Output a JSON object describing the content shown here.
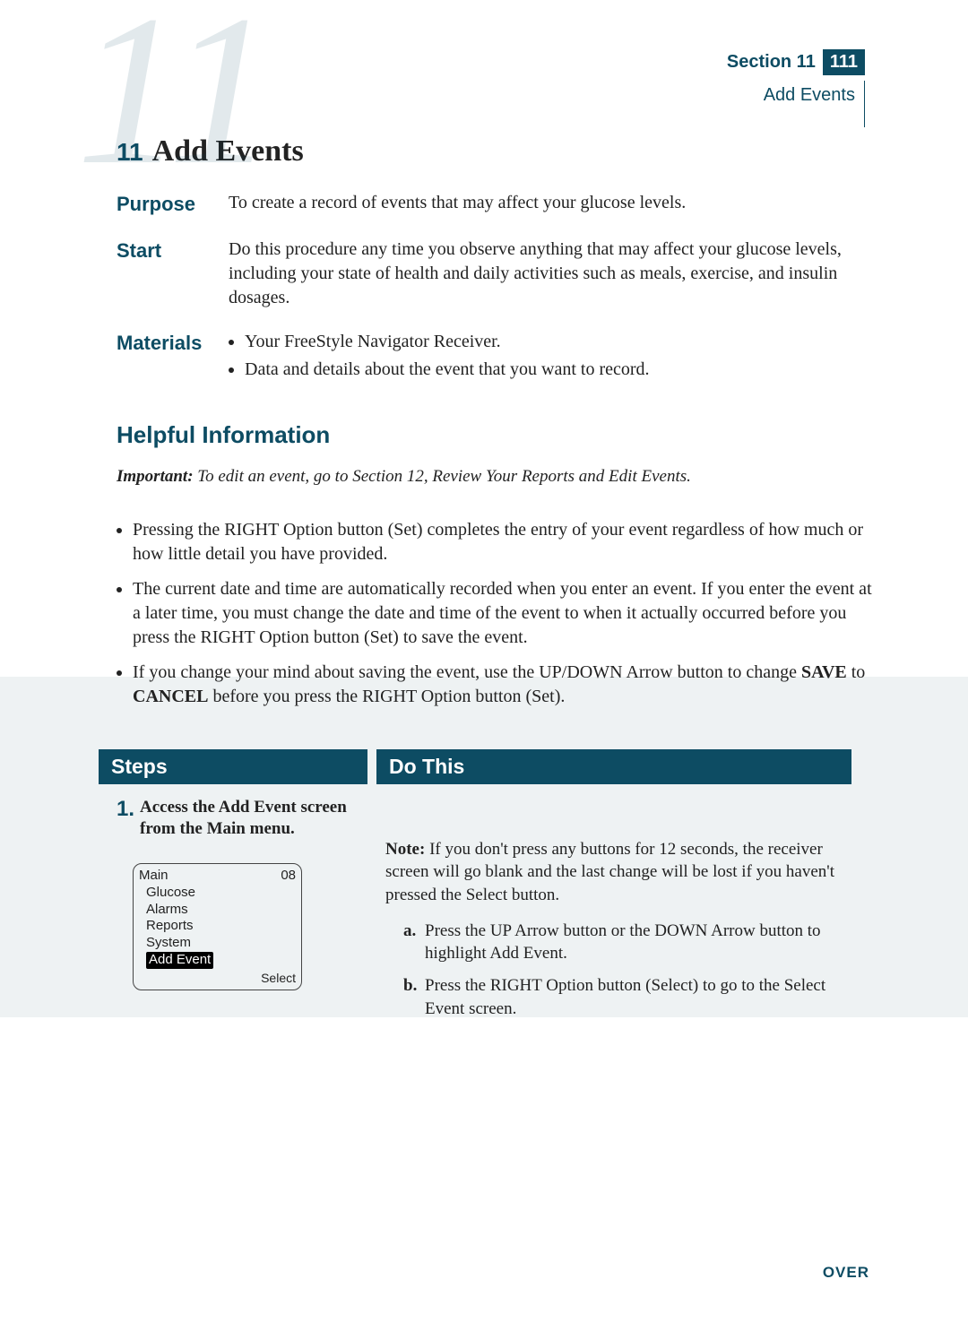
{
  "header": {
    "section_label": "Section 11",
    "page_number": "111",
    "section_name": "Add Events",
    "bg_number": "11",
    "chapter_number": "11",
    "chapter_title": "Add Events"
  },
  "info": {
    "purpose_label": "Purpose",
    "purpose_text": "To create a record of events that may affect your glucose levels.",
    "start_label": "Start",
    "start_text": "Do this procedure any time you observe anything that may affect your glucose levels, including your state of health and daily activities such as meals, exercise, and insulin dosages.",
    "materials_label": "Materials",
    "materials": [
      "Your FreeStyle Navigator Receiver.",
      "Data and details about the event that you want to record."
    ]
  },
  "helpful": {
    "heading": "Helpful Information",
    "important_label": "Important:",
    "important_text": " To edit an event, go to Section 12, Review Your Reports and Edit Events.",
    "tips": [
      "Pressing the RIGHT Option button (Set) completes the entry of your event regardless of how much or how little detail you have provided.",
      "The current date and time are automatically recorded when you enter an event. If you enter the event at a later time, you must change the date and time of the event to when it actually occurred before you press the RIGHT Option button (Set) to save the event."
    ],
    "tip3_pre": "If you change your mind about saving the event, use the UP/DOWN Arrow button to change ",
    "tip3_b1": "SAVE",
    "tip3_mid": " to ",
    "tip3_b2": "CANCEL",
    "tip3_post": " before you press the RIGHT Option button (Set)."
  },
  "columns": {
    "steps_header": "Steps",
    "dothis_header": "Do This"
  },
  "step1": {
    "number": "1.",
    "title": "Access the Add Event screen from the Main menu.",
    "screen": {
      "top_left": "Main",
      "top_right": "08",
      "rows": [
        "Glucose",
        "Alarms",
        "Reports",
        "System"
      ],
      "highlight": "Add Event",
      "bottom_right": "Select"
    }
  },
  "dothis": {
    "note_label": "Note:",
    "note_text": " If you don't press any buttons for 12 seconds, the receiver screen will go blank and the last change will be lost if you haven't pressed the Select button.",
    "a_label": "a.",
    "a_text": "Press the UP Arrow button or the DOWN Arrow button to highlight Add Event.",
    "b_label": "b.",
    "b_text": "Press the RIGHT Option button (Select) to go to the Select Event screen."
  },
  "footer": {
    "over": "OVER"
  }
}
